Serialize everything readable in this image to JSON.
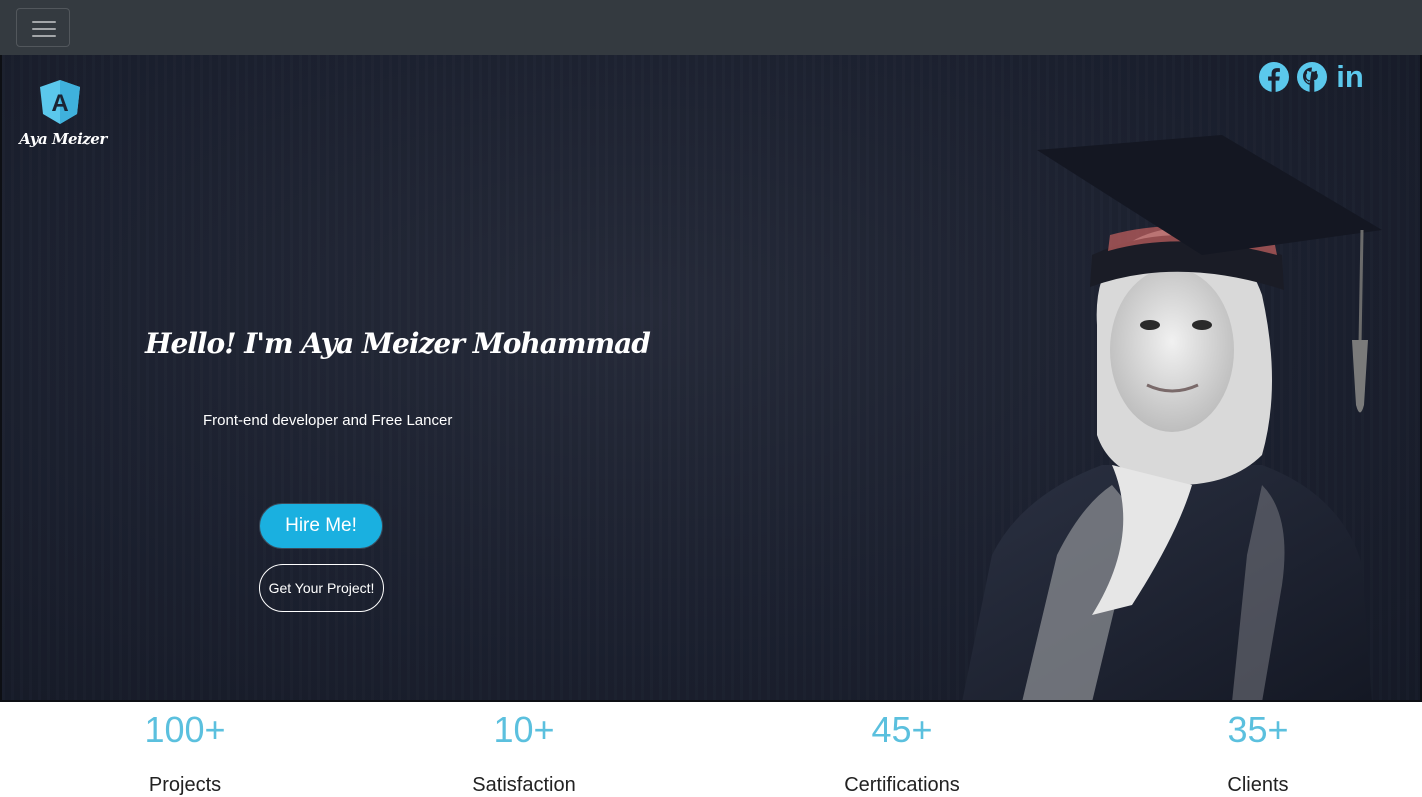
{
  "navbar": {
    "toggler_icon": "hamburger-icon"
  },
  "brand": {
    "logo_icon": "angular-shield-icon",
    "name": "Aya Meizer"
  },
  "social": {
    "icons": [
      "facebook-icon",
      "github-icon",
      "linkedin-icon"
    ],
    "linkedin_glyph": "in",
    "color": "#5bc8ec"
  },
  "hero": {
    "greeting": "Hello! I'm Aya Meizer Mohammad",
    "subtitle": "Front-end developer and Free Lancer",
    "hire_label": "Hire Me!",
    "project_label": "Get Your Project!"
  },
  "stats": [
    {
      "value": "100+",
      "label": "Projects"
    },
    {
      "value": "10+",
      "label": "Satisfaction"
    },
    {
      "value": "45+",
      "label": "Certifications"
    },
    {
      "value": "35+",
      "label": "Clients"
    }
  ],
  "colors": {
    "accent": "#5bc0de",
    "button": "#1ab0e0",
    "navbar": "#343a40",
    "hero_bg": "#1c2130"
  }
}
